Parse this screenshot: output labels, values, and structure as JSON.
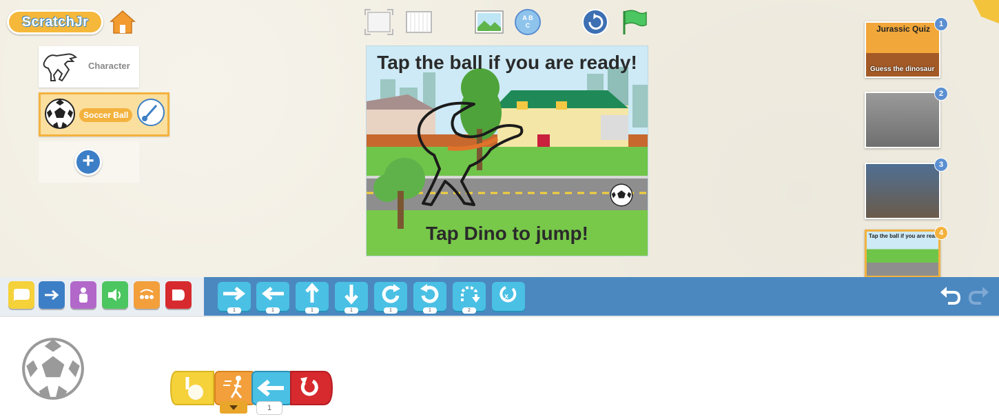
{
  "app": {
    "logo_text": "ScratchJr"
  },
  "sprites": [
    {
      "label": "Character",
      "selected": false
    },
    {
      "label": "Soccer Ball",
      "selected": true
    }
  ],
  "stage": {
    "title_top": "Tap the ball if you are ready!",
    "title_bottom": "Tap Dino to jump!"
  },
  "pages": [
    {
      "number": "1",
      "title": "Jurassic Quiz",
      "caption": "Guess the dinosaur"
    },
    {
      "number": "2"
    },
    {
      "number": "3"
    },
    {
      "number": "4",
      "caption": "Tap the ball if you are ready!",
      "selected": true
    }
  ],
  "motion_blocks": [
    "1",
    "1",
    "1",
    "1",
    "1",
    "1",
    "2",
    "1"
  ],
  "script": {
    "move_amount": "1"
  },
  "colors": {
    "trigger": "#f5d13a",
    "motion": "#4ac0e4",
    "looks": "#b268c9",
    "sound": "#4cc660",
    "control": "#f29f3c",
    "end": "#d72a2e",
    "palette_bar": "#4b88c0"
  }
}
